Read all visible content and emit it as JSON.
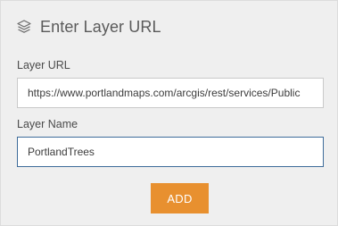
{
  "header": {
    "icon": "layers-icon",
    "title": "Enter Layer URL"
  },
  "layer_url": {
    "label": "Layer URL",
    "value": "https://www.portlandmaps.com/arcgis/rest/services/Public"
  },
  "layer_name": {
    "label": "Layer Name",
    "value": "PortlandTrees"
  },
  "actions": {
    "add_label": "ADD"
  },
  "colors": {
    "accent": "#e8902f",
    "focus_border": "#3e6c9a",
    "panel_bg": "#efefef"
  }
}
